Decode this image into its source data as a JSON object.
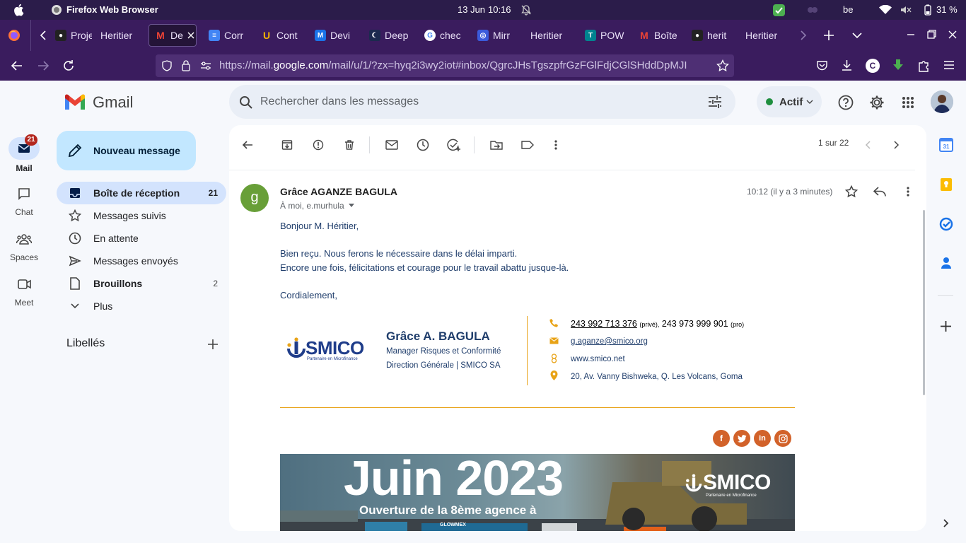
{
  "os": {
    "app_name": "Firefox Web Browser",
    "date": "13 Jun",
    "time": "10:16",
    "keyboard": "be",
    "battery": "31 %"
  },
  "tabs": [
    {
      "label": "Proje",
      "favicon": "github-icon",
      "color": "#222222"
    },
    {
      "label": "Heritier",
      "favicon": "none",
      "color": ""
    },
    {
      "label": "De",
      "favicon": "gmail-icon",
      "color": "#ea4335",
      "active": true
    },
    {
      "label": "Corr",
      "favicon": "docs-icon",
      "color": "#4285f4"
    },
    {
      "label": "Cont",
      "favicon": "u-icon",
      "color": "#f4b400"
    },
    {
      "label": "Devi",
      "favicon": "m-icon",
      "color": "#1a73e8"
    },
    {
      "label": "Deep",
      "favicon": "moon-icon",
      "color": "#1b2a4e"
    },
    {
      "label": "chec",
      "favicon": "google-icon",
      "color": "#ffffff"
    },
    {
      "label": "Mirr",
      "favicon": "globe-icon",
      "color": "#3b5bdb"
    },
    {
      "label": "Heritier",
      "favicon": "none",
      "color": ""
    },
    {
      "label": "POW",
      "favicon": "t9-icon",
      "color": "#00838f"
    },
    {
      "label": "Boîte",
      "favicon": "gmail-icon",
      "color": "#ea4335"
    },
    {
      "label": "herit",
      "favicon": "github-icon",
      "color": "#222222"
    },
    {
      "label": "Heritier",
      "favicon": "none",
      "color": ""
    }
  ],
  "url": {
    "prefix": "https://mail.",
    "domain": "google.com",
    "suffix": "/mail/u/1/?zx=hyq2i3wy2iot#inbox/QgrcJHsTgszpfrGzFGlFdjCGlSHddDpMJI"
  },
  "gmail": {
    "logo_text": "Gmail",
    "search_placeholder": "Rechercher dans les messages",
    "status": "Actif",
    "compose_label": "Nouveau message",
    "rail": [
      {
        "label": "Mail",
        "badge": "21"
      },
      {
        "label": "Chat"
      },
      {
        "label": "Spaces"
      },
      {
        "label": "Meet"
      }
    ],
    "nav": [
      {
        "label": "Boîte de réception",
        "count": "21",
        "bold": true,
        "active": true
      },
      {
        "label": "Messages suivis",
        "count": ""
      },
      {
        "label": "En attente",
        "count": ""
      },
      {
        "label": "Messages envoyés",
        "count": ""
      },
      {
        "label": "Brouillons",
        "count": "2",
        "bold": true
      },
      {
        "label": "Plus",
        "count": ""
      }
    ],
    "labels_title": "Libellés",
    "pager": "1 sur 22"
  },
  "message": {
    "avatar_letter": "g",
    "avatar_color": "#689f38",
    "sender": "Grâce AGANZE BAGULA",
    "recipients": "À moi, e.murhula",
    "time": "10:12 (il y a 3 minutes)",
    "greeting": "Bonjour M. Héritier,",
    "line1": "Bien reçu. Nous ferons le nécessaire dans le délai imparti.",
    "line2": "Encore une fois, félicitations et courage pour le travail abattu jusque-là.",
    "closing": "Cordialement,"
  },
  "signature": {
    "logo": "SMICO",
    "logo_tagline": "Partenaire en Microfinance",
    "name": "Grâce A. BAGULA",
    "title": "Manager Risques et Conformité",
    "department": "Direction Générale | SMICO SA",
    "phone1": "243 992 713 376",
    "phone1_note": "(privé),",
    "phone2": "243 973 999 901",
    "phone2_note": "(pro)",
    "email": "g.aganze@smico.org",
    "website": "www.smico.net",
    "address": "20, Av. Vanny Bishweka, Q. Les Volcans, Goma",
    "accent": "#e8a317"
  },
  "banner": {
    "headline": "Juin 2023",
    "subline": "Ouverture de la 8ème agence à",
    "logo": "SMICO",
    "logo_tagline": "Partenaire en Microfinance",
    "sign_text": "GLOWMEX"
  }
}
